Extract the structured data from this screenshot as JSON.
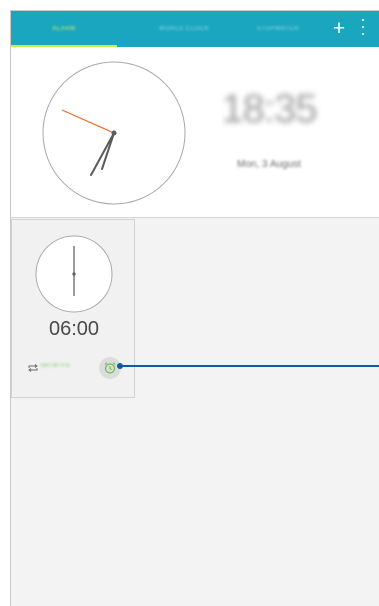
{
  "tabs": [
    {
      "label": "ALARM",
      "active": true
    },
    {
      "label": "WORLD CLOCK",
      "active": false
    },
    {
      "label": "STOPWATCH",
      "active": false
    }
  ],
  "toolbar": {
    "add_icon": "plus-icon",
    "add_glyph": "+",
    "menu_icon": "more-vert-icon"
  },
  "clock": {
    "digital_time": "18:35",
    "date": "Mon, 3 August"
  },
  "alarm": {
    "time": "06:00",
    "repeat_icon": "repeat-icon",
    "repeat_days": "SMTWTFS",
    "toggle_icon": "alarm-clock-icon",
    "enabled": true
  },
  "colors": {
    "accent": "#1ba6bf",
    "active_tab": "#c7ec4b",
    "second_hand": "#ee6b2a",
    "callout": "#0a5da2",
    "alarm_on": "#6cc04a"
  }
}
